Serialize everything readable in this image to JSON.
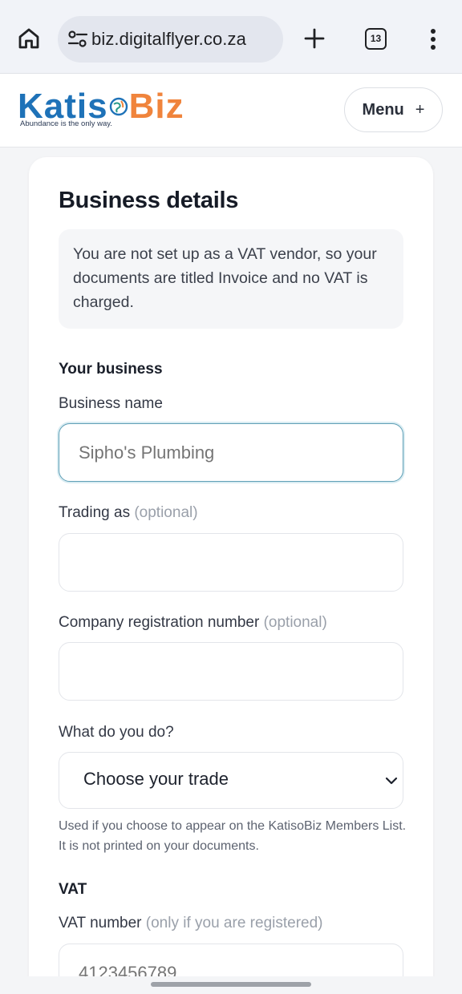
{
  "browser": {
    "url": "biz.digitalflyer.co.za",
    "tab_count": "13"
  },
  "site": {
    "logo_part1": "Katis",
    "logo_part2": "Biz",
    "tagline": "Abundance is the only way.",
    "menu_label": "Menu",
    "menu_icon": "+"
  },
  "page": {
    "title": "Business details",
    "notice": "You are not set up as a VAT vendor, so your documents are titled Invoice and no VAT is charged."
  },
  "form": {
    "your_business_heading": "Your business",
    "business_name_label": "Business name",
    "business_name_placeholder": "Sipho's Plumbing",
    "trading_as_label": "Trading as",
    "trading_as_optional": "(optional)",
    "trading_as_value": "",
    "company_reg_label": "Company registration number",
    "company_reg_optional": "(optional)",
    "company_reg_value": "",
    "trade_label": "What do you do?",
    "trade_selected": "Choose your trade",
    "trade_help": "Used if you choose to appear on the KatisoBiz Members List. It is not printed on your documents.",
    "vat_heading": "VAT",
    "vat_number_label": "VAT number",
    "vat_number_note": "(only if you are registered)",
    "vat_number_placeholder": "4123456789"
  },
  "colors": {
    "brand_blue": "#1e72b8",
    "brand_orange": "#f0843c",
    "focus_border": "#5f9fb6"
  }
}
